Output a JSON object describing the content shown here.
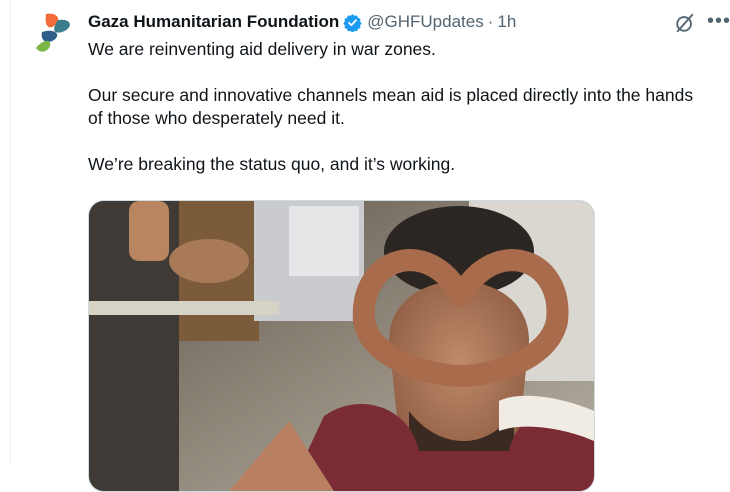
{
  "tweet": {
    "display_name": "Gaza Humanitarian Foundation",
    "verified": true,
    "handle": "@GHFUpdates",
    "separator": "·",
    "time": "1h",
    "paragraphs": [
      "We are reinventing aid delivery in war zones.",
      "Our secure and innovative channels mean aid is placed directly into the hands of those who desperately need it.",
      "We’re breaking the status quo, and it’s working."
    ],
    "media": {
      "kind": "photo",
      "subject": "man making heart shape with hands"
    }
  },
  "icons": {
    "avatar": "ghf-logo-icon",
    "verified": "verified-badge-icon",
    "grok": "grok-icon",
    "more": "more-icon"
  },
  "colors": {
    "verified_blue": "#1d9bf0",
    "secondary_text": "#536471",
    "logo_orange": "#f26b3a",
    "logo_green": "#7ab648",
    "logo_teal": "#3a7d8c"
  }
}
